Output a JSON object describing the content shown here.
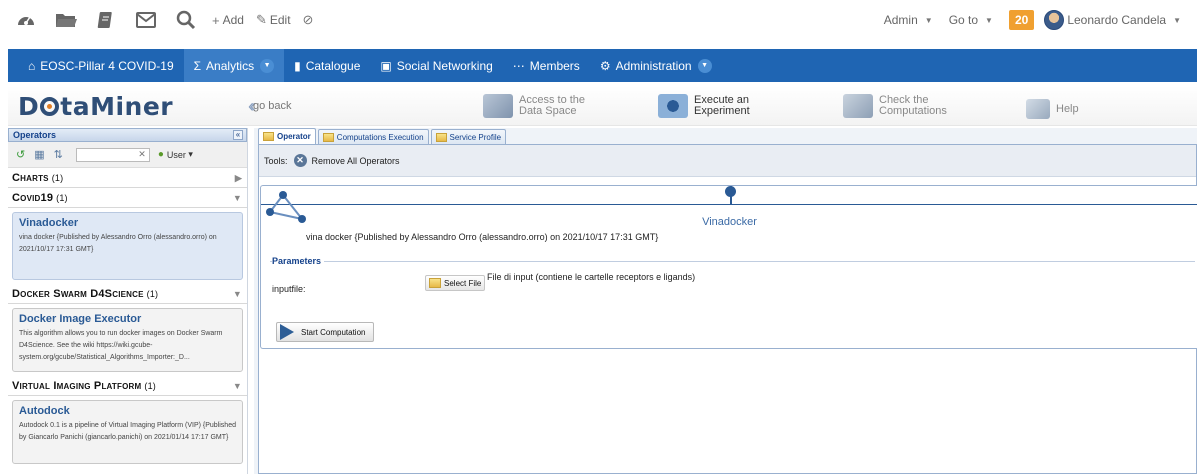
{
  "topbar": {
    "icons": [
      "dashboard-icon",
      "folder-icon",
      "notes-icon",
      "mail-icon",
      "search-icon"
    ],
    "add_label": "Add",
    "edit_label": "Edit",
    "admin_label": "Admin",
    "goto_label": "Go to",
    "notification_count": "20",
    "user_name": "Leonardo Candela"
  },
  "navbar": {
    "items": [
      {
        "label": "EOSC-Pillar 4 COVID-19",
        "icon": "home-icon"
      },
      {
        "label": "Analytics",
        "icon": "sigma-icon"
      },
      {
        "label": "Catalogue",
        "icon": "book-icon"
      },
      {
        "label": "Social Networking",
        "icon": "chat-icon"
      },
      {
        "label": "Members",
        "icon": "people-icon"
      },
      {
        "label": "Administration",
        "icon": "gear-icon"
      }
    ]
  },
  "dataminer": {
    "logo_text": "DataMiner",
    "go_back": "go back",
    "tools": [
      {
        "line1": "Access to the",
        "line2": "Data Space"
      },
      {
        "line1": "Execute an",
        "line2": "Experiment"
      },
      {
        "line1": "Check the",
        "line2": "Computations"
      },
      {
        "line1": "Help",
        "line2": ""
      }
    ]
  },
  "operators_panel": {
    "title": "Operators",
    "user_filter": "User",
    "categories": [
      {
        "name": "Charts",
        "count": "(1)",
        "expanded": false,
        "operators": []
      },
      {
        "name": "Covid19",
        "count": "(1)",
        "expanded": true,
        "operators": [
          {
            "title": "Vinadocker",
            "desc": "vina docker {Published by Alessandro Orro (alessandro.orro) on 2021/10/17 17:31 GMT}",
            "selected": true
          }
        ]
      },
      {
        "name": "Docker Swarm D4Science",
        "count": "(1)",
        "expanded": true,
        "operators": [
          {
            "title": "Docker Image Executor",
            "desc": "This algorithm allows you to run docker images on Docker Swarm D4Science. See the wiki https://wiki.gcube-system.org/gcube/Statistical_Algorithms_Importer:_D...",
            "selected": false
          }
        ]
      },
      {
        "name": "Virtual Imaging Platform",
        "count": "(1)",
        "expanded": true,
        "operators": [
          {
            "title": "Autodock",
            "desc": "Autodock 0.1 is a pipeline of Virtual Imaging Platform (VIP) {Published by Giancarlo Panichi (giancarlo.panichi) on 2021/01/14 17:17 GMT}",
            "selected": false
          }
        ]
      }
    ]
  },
  "tabs": [
    {
      "label": "Operator",
      "active": true
    },
    {
      "label": "Computations Execution",
      "active": false
    },
    {
      "label": "Service Profile",
      "active": false
    }
  ],
  "tools_bar": {
    "label": "Tools:",
    "remove_all": "Remove All Operators"
  },
  "operator_detail": {
    "name": "Vinadocker",
    "published": "vina docker {Published by Alessandro Orro (alessandro.orro) on 2021/10/17 17:31 GMT}",
    "parameters_label": "Parameters",
    "param_label": "inputfile:",
    "select_file": "Select File",
    "param_help": "File di input (contiene le cartelle receptors e ligands)",
    "start_label": "Start Computation"
  }
}
